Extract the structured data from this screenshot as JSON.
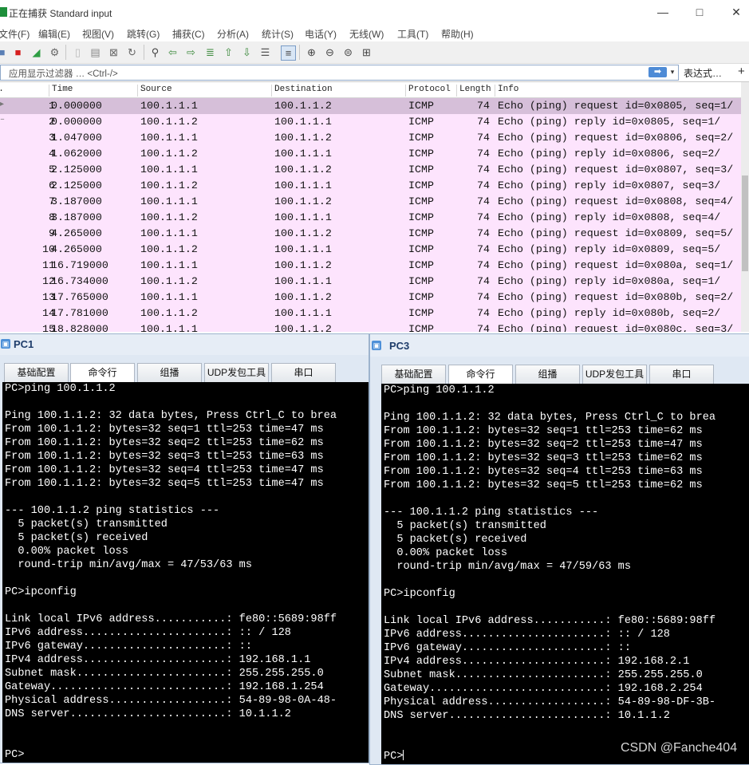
{
  "wireshark": {
    "title": "正在捕获 Standard input",
    "window_controls": [
      "—",
      "□",
      "✕"
    ],
    "menu": [
      "文件(F)",
      "编辑(E)",
      "视图(V)",
      "跳转(G)",
      "捕获(C)",
      "分析(A)",
      "统计(S)",
      "电话(Y)",
      "无线(W)",
      "工具(T)",
      "帮助(H)"
    ],
    "filter_placeholder": "应用显示过滤器 … <Ctrl-/>",
    "filter_apply": "➡",
    "filter_dropdown": "▾",
    "expression_label": "表达式…",
    "add_filter": "+",
    "columns": [
      "No.",
      "Time",
      "Source",
      "Destination",
      "Protocol",
      "Length",
      "Info"
    ],
    "rows": [
      {
        "no": "1",
        "time": "0.000000",
        "src": "100.1.1.1",
        "dst": "100.1.1.2",
        "proto": "ICMP",
        "len": "74",
        "info": "Echo (ping) request  id=0x0805, seq=1/"
      },
      {
        "no": "2",
        "time": "0.000000",
        "src": "100.1.1.2",
        "dst": "100.1.1.1",
        "proto": "ICMP",
        "len": "74",
        "info": "Echo (ping) reply    id=0x0805, seq=1/"
      },
      {
        "no": "3",
        "time": "1.047000",
        "src": "100.1.1.1",
        "dst": "100.1.1.2",
        "proto": "ICMP",
        "len": "74",
        "info": "Echo (ping) request  id=0x0806, seq=2/"
      },
      {
        "no": "4",
        "time": "1.062000",
        "src": "100.1.1.2",
        "dst": "100.1.1.1",
        "proto": "ICMP",
        "len": "74",
        "info": "Echo (ping) reply    id=0x0806, seq=2/"
      },
      {
        "no": "5",
        "time": "2.125000",
        "src": "100.1.1.1",
        "dst": "100.1.1.2",
        "proto": "ICMP",
        "len": "74",
        "info": "Echo (ping) request  id=0x0807, seq=3/"
      },
      {
        "no": "6",
        "time": "2.125000",
        "src": "100.1.1.2",
        "dst": "100.1.1.1",
        "proto": "ICMP",
        "len": "74",
        "info": "Echo (ping) reply    id=0x0807, seq=3/"
      },
      {
        "no": "7",
        "time": "3.187000",
        "src": "100.1.1.1",
        "dst": "100.1.1.2",
        "proto": "ICMP",
        "len": "74",
        "info": "Echo (ping) request  id=0x0808, seq=4/"
      },
      {
        "no": "8",
        "time": "3.187000",
        "src": "100.1.1.2",
        "dst": "100.1.1.1",
        "proto": "ICMP",
        "len": "74",
        "info": "Echo (ping) reply    id=0x0808, seq=4/"
      },
      {
        "no": "9",
        "time": "4.265000",
        "src": "100.1.1.1",
        "dst": "100.1.1.2",
        "proto": "ICMP",
        "len": "74",
        "info": "Echo (ping) request  id=0x0809, seq=5/"
      },
      {
        "no": "10",
        "time": "4.265000",
        "src": "100.1.1.2",
        "dst": "100.1.1.1",
        "proto": "ICMP",
        "len": "74",
        "info": "Echo (ping) reply    id=0x0809, seq=5/"
      },
      {
        "no": "11",
        "time": "16.719000",
        "src": "100.1.1.1",
        "dst": "100.1.1.2",
        "proto": "ICMP",
        "len": "74",
        "info": "Echo (ping) request  id=0x080a, seq=1/"
      },
      {
        "no": "12",
        "time": "16.734000",
        "src": "100.1.1.2",
        "dst": "100.1.1.1",
        "proto": "ICMP",
        "len": "74",
        "info": "Echo (ping) reply    id=0x080a, seq=1/"
      },
      {
        "no": "13",
        "time": "17.765000",
        "src": "100.1.1.1",
        "dst": "100.1.1.2",
        "proto": "ICMP",
        "len": "74",
        "info": "Echo (ping) request  id=0x080b, seq=2/"
      },
      {
        "no": "14",
        "time": "17.781000",
        "src": "100.1.1.2",
        "dst": "100.1.1.1",
        "proto": "ICMP",
        "len": "74",
        "info": "Echo (ping) reply    id=0x080b, seq=2/"
      },
      {
        "no": "15",
        "time": "18.828000",
        "src": "100.1.1.1",
        "dst": "100.1.1.2",
        "proto": "ICMP",
        "len": "74",
        "info": "Echo (ping) request  id=0x080c, seq=3/"
      }
    ],
    "row_color": "#fde4fd",
    "selected_row_color": "#d6bfd9"
  },
  "tabs": [
    "基础配置",
    "命令行",
    "组播",
    "UDP发包工具",
    "串口"
  ],
  "pc1": {
    "title": "PC1",
    "console": [
      "PC>ping 100.1.1.2",
      "",
      "Ping 100.1.1.2: 32 data bytes, Press Ctrl_C to brea",
      "From 100.1.1.2: bytes=32 seq=1 ttl=253 time=47 ms",
      "From 100.1.1.2: bytes=32 seq=2 ttl=253 time=62 ms",
      "From 100.1.1.2: bytes=32 seq=3 ttl=253 time=63 ms",
      "From 100.1.1.2: bytes=32 seq=4 ttl=253 time=47 ms",
      "From 100.1.1.2: bytes=32 seq=5 ttl=253 time=47 ms",
      "",
      "--- 100.1.1.2 ping statistics ---",
      "  5 packet(s) transmitted",
      "  5 packet(s) received",
      "  0.00% packet loss",
      "  round-trip min/avg/max = 47/53/63 ms",
      "",
      "PC>ipconfig",
      "",
      "Link local IPv6 address...........: fe80::5689:98ff",
      "IPv6 address......................: :: / 128",
      "IPv6 gateway......................: ::",
      "IPv4 address......................: 192.168.1.1",
      "Subnet mask.......................: 255.255.255.0",
      "Gateway...........................: 192.168.1.254",
      "Physical address..................: 54-89-98-0A-48-",
      "DNS server........................: 10.1.1.2",
      "",
      "",
      "PC>"
    ]
  },
  "pc3": {
    "title": "PC3",
    "console": [
      "PC>ping 100.1.1.2",
      "",
      "Ping 100.1.1.2: 32 data bytes, Press Ctrl_C to brea",
      "From 100.1.1.2: bytes=32 seq=1 ttl=253 time=62 ms",
      "From 100.1.1.2: bytes=32 seq=2 ttl=253 time=47 ms",
      "From 100.1.1.2: bytes=32 seq=3 ttl=253 time=62 ms",
      "From 100.1.1.2: bytes=32 seq=4 ttl=253 time=63 ms",
      "From 100.1.1.2: bytes=32 seq=5 ttl=253 time=62 ms",
      "",
      "--- 100.1.1.2 ping statistics ---",
      "  5 packet(s) transmitted",
      "  5 packet(s) received",
      "  0.00% packet loss",
      "  round-trip min/avg/max = 47/59/63 ms",
      "",
      "PC>ipconfig",
      "",
      "Link local IPv6 address...........: fe80::5689:98ff",
      "IPv6 address......................: :: / 128",
      "IPv6 gateway......................: ::",
      "IPv4 address......................: 192.168.2.1",
      "Subnet mask.......................: 255.255.255.0",
      "Gateway...........................: 192.168.2.254",
      "Physical address..................: 54-89-98-DF-3B-",
      "DNS server........................: 10.1.1.2",
      "",
      "",
      "PC>"
    ]
  },
  "watermark": "CSDN @Fanche404"
}
